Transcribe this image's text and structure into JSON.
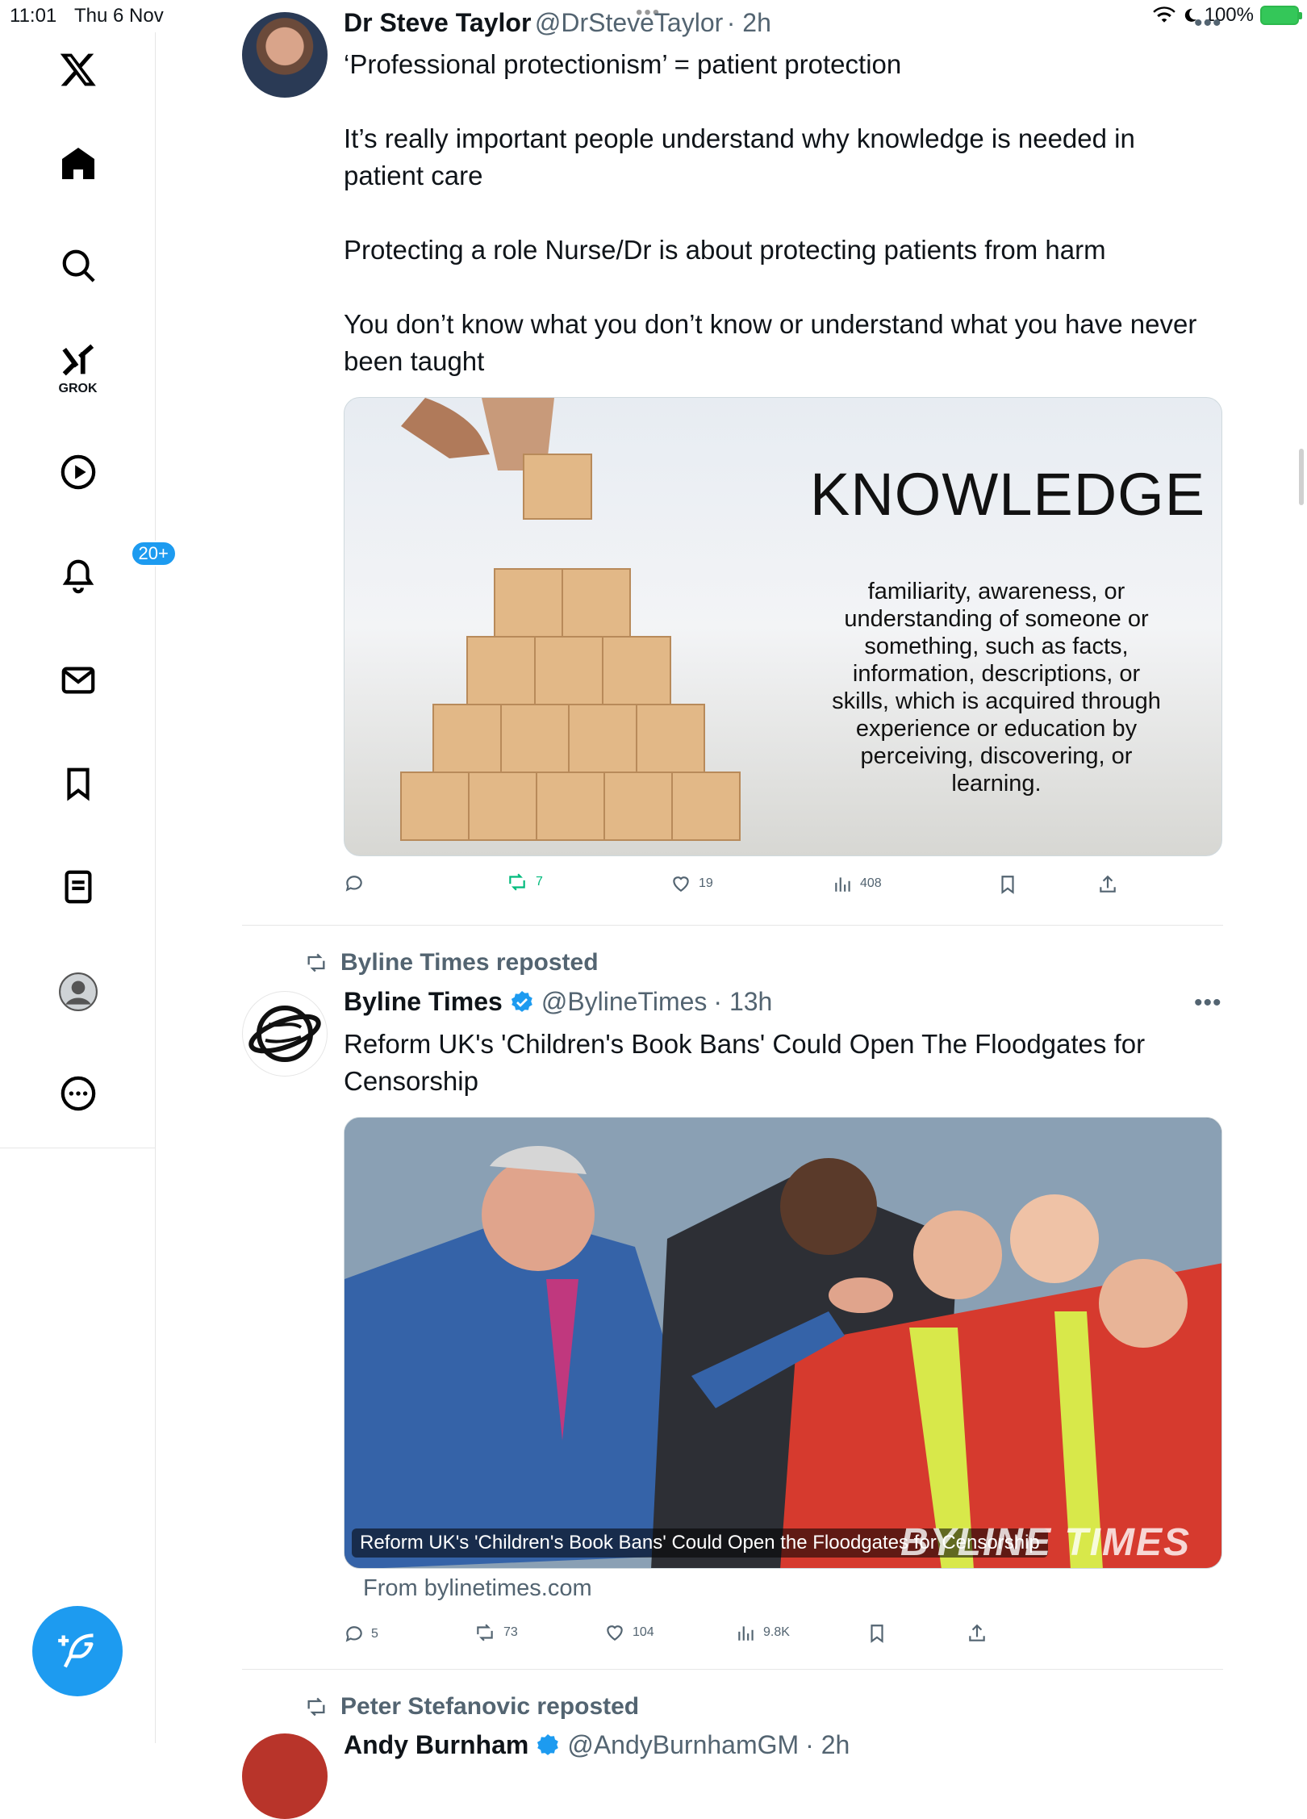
{
  "status_bar": {
    "time": "11:01",
    "date": "Thu 6 Nov",
    "battery": "100%"
  },
  "sidebar": {
    "grok_label": "GROK",
    "notifications_badge": "20+"
  },
  "tweets": [
    {
      "name": "Dr Steve Taylor",
      "handle": "@DrSteveTaylor",
      "time": "· 2h",
      "text": "‘Professional protectionism’ = patient protection\n\nIt’s really important people understand why knowledge is needed in patient care\n\nProtecting a role Nurse/Dr is about protecting patients from harm\n\nYou don’t know what you don’t know or understand what you have never been taught",
      "media": {
        "title": "KNOWLEDGE",
        "definition": "familiarity, awareness, or understanding of someone or something, such as facts, information, descriptions, or skills, which is acquired through experience or education by perceiving, discovering, or learning."
      },
      "stats": {
        "replies": "",
        "reposts": "7",
        "likes": "19",
        "views": "408"
      }
    },
    {
      "repost_by": "Byline Times reposted",
      "name": "Byline Times",
      "handle": "@BylineTimes",
      "time": "· 13h",
      "text": "Reform UK's 'Children's Book Bans' Could Open The Floodgates for Censorship",
      "media": {
        "caption": "Reform UK's 'Children's Book Bans' Could Open the Floodgates for Censorship",
        "watermark": "BYLINE TIMES"
      },
      "source": "From bylinetimes.com",
      "stats": {
        "replies": "5",
        "reposts": "73",
        "likes": "104",
        "views": "9.8K"
      }
    },
    {
      "repost_by": "Peter Stefanovic reposted",
      "name": "Andy Burnham",
      "handle": "@AndyBurnhamGM",
      "time": "· 2h"
    }
  ],
  "colors": {
    "accent": "#1d9bf0",
    "repost_green": "#00ba7c",
    "muted": "#536471"
  }
}
